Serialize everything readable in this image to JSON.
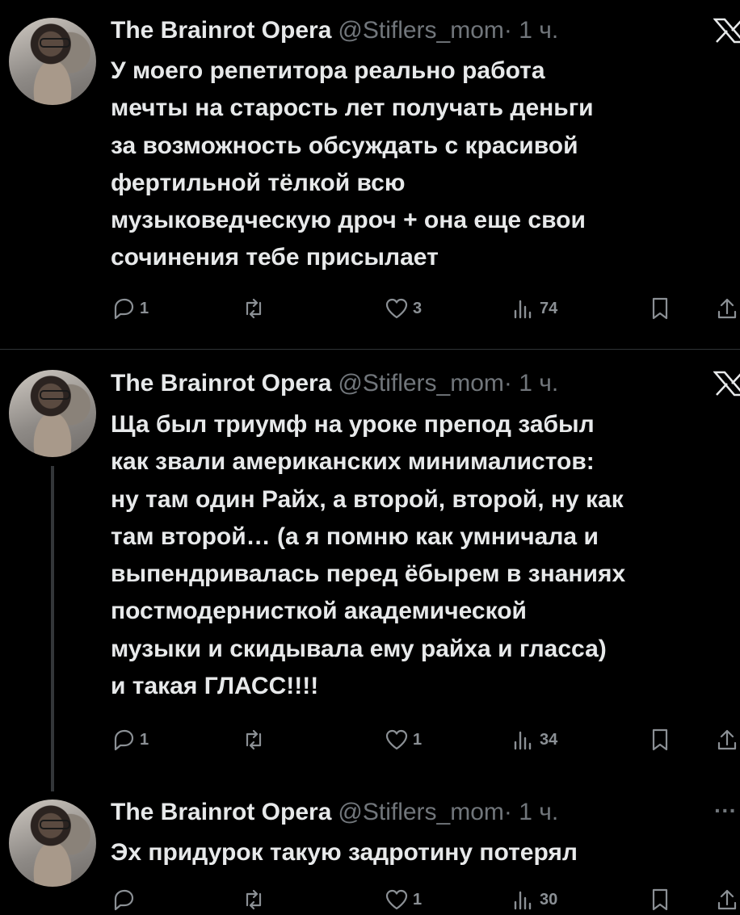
{
  "tweets": [
    {
      "author_name": "The Brainrot Opera",
      "handle": "@Stiflers_mom",
      "time": "· 1 ч.",
      "corner_icon": "x-logo-icon",
      "text": "У моего репетитора реально работа\nмечты на старость лет получать деньги\nза возможность обсуждать с красивой\nфертильной тёлкой всю\nмузыковедческую дроч + она еще свои\nсочинения тебе присылает",
      "replies": "1",
      "reposts": "",
      "likes": "3",
      "views": "74"
    },
    {
      "author_name": "The Brainrot Opera",
      "handle": "@Stiflers_mom",
      "time": "· 1 ч.",
      "corner_icon": "x-logo-icon",
      "text": "Ща был триумф на уроке препод забыл\nкак звали американских минималистов:\nну там один Райх, а второй, второй, ну как\nтам второй… (а я помню как умничала и\nвыпендривалась перед ёбырем в знаниях\nпостмодернисткой академической\nмузыки и скидывала ему райха и гласса)\nи такая ГЛАСС!!!!",
      "replies": "1",
      "reposts": "",
      "likes": "1",
      "views": "34"
    },
    {
      "author_name": "The Brainrot Opera",
      "handle": "@Stiflers_mom",
      "time": "· 1 ч.",
      "corner_icon": "more-icon",
      "more_label": "···",
      "text": "Эх придурок такую задротину потерял",
      "replies": "",
      "reposts": "",
      "likes": "1",
      "views": "30"
    }
  ]
}
